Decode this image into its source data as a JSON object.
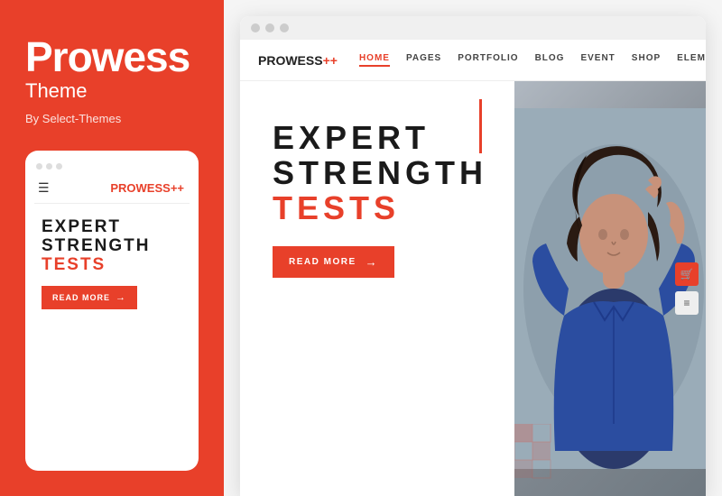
{
  "left": {
    "title": "Prowess",
    "subtitle": "Theme",
    "by": "By Select-Themes"
  },
  "mobile": {
    "logo": "PROWESS",
    "logo_plus": "++",
    "hero_line1": "EXPERT",
    "hero_line2": "STRENGTH",
    "hero_accent": "TESTS",
    "read_more": "READ MORE"
  },
  "site": {
    "logo": "PROWESS",
    "logo_plus": "++",
    "nav": [
      "HOME",
      "PAGES",
      "PORTFOLIO",
      "BLOG",
      "EVENT",
      "SHOP",
      "ELEMENTS"
    ],
    "active_nav": "HOME",
    "hero_line1": "EXPERT",
    "hero_line2": "STRENGTH",
    "hero_accent": "TESTS",
    "read_more": "READ MORE"
  },
  "colors": {
    "accent": "#e8402a",
    "dark": "#1a1a1a",
    "light": "#fff"
  }
}
